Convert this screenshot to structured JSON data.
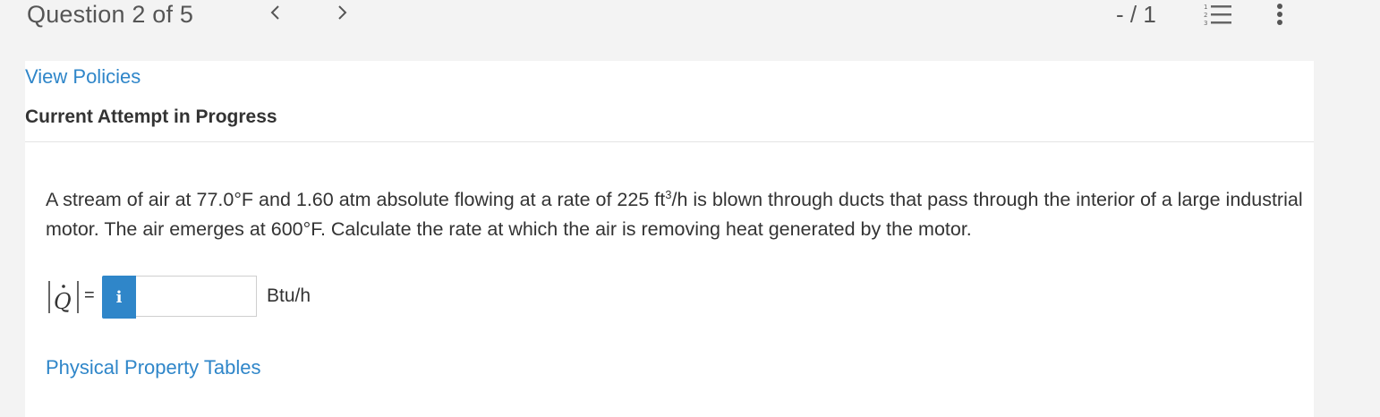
{
  "header": {
    "question_counter": "Question 2 of 5",
    "prev_symbol": "<",
    "next_symbol": ">",
    "score": "- / 1",
    "icons": [
      "list-numbered-icon",
      "more-vertical-icon"
    ]
  },
  "links": {
    "view_policies": "View Policies",
    "physical_property_tables": "Physical Property Tables"
  },
  "status": {
    "attempt": "Current Attempt in Progress"
  },
  "question": {
    "text_part1": "A stream of air at 77.0°F and 1.60 atm absolute flowing at a rate of 225 ft",
    "superscript": "3",
    "text_part2": "/h is blown through ducts that pass through the interior of a large industrial motor. The air emerges at 600°F. Calculate the rate at which the air is removing heat generated by the motor."
  },
  "answer": {
    "variable": "Q",
    "equals": "=",
    "info_label": "i",
    "value": "",
    "unit": "Btu/h"
  },
  "colors": {
    "link": "#2f86c9",
    "info_button": "#2f86c9",
    "background": "#f3f3f3",
    "card": "#ffffff"
  }
}
